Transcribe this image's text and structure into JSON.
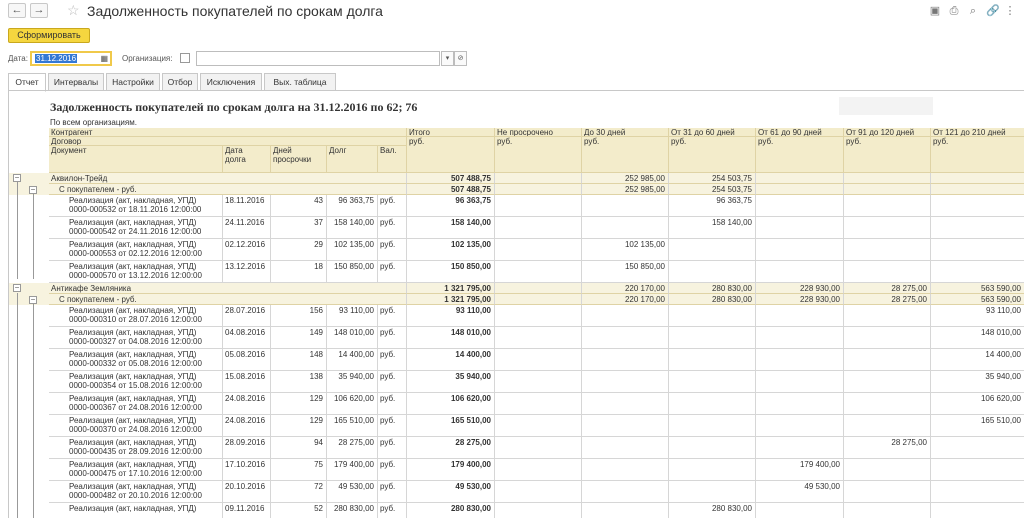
{
  "window": {
    "title": "Задолженность покупателей по срокам долга",
    "back": "←",
    "forward": "→",
    "star": "☆",
    "right_icons": [
      "▣",
      "⎙",
      "⌕",
      "🔗",
      "⋮"
    ]
  },
  "toolbar": {
    "generate_label": "Сформировать"
  },
  "params": {
    "date_label": "Дата:",
    "date_value": "31.12.2016",
    "org_label": "Организация:",
    "org_value": ""
  },
  "tabs": [
    {
      "label": "Отчет",
      "active": true
    },
    {
      "label": "Интервалы"
    },
    {
      "label": "Настройки"
    },
    {
      "label": "Отбор"
    },
    {
      "label": "Исключения"
    },
    {
      "label": "Вых. таблица"
    }
  ],
  "report": {
    "title": "Задолженность покупателей по срокам долга на 31.12.2016  по 62; 76",
    "subtitle": "По всем организациям.",
    "header": {
      "kontragent": "Контрагент",
      "dogovor": "Договор",
      "document": "Документ",
      "date": "Дата долга",
      "date_l1": "Дата",
      "date_l2": "долга",
      "days_l1": "Дней",
      "days_l2": "просрочки",
      "debt": "Долг",
      "cur": "Вал.",
      "columns": [
        "Итого",
        "Не просрочено",
        "До 30 дней",
        "От 31 до 60 дней",
        "От 61 до 90 дней",
        "От 91 до 120 дней",
        "От 121 до 210 дней"
      ],
      "currency": "руб."
    },
    "rows": [
      {
        "type": "c",
        "name": "Аквилон-Трейд",
        "vals": [
          "507 488,75",
          "",
          "252 985,00",
          "254 503,75",
          "",
          "",
          ""
        ]
      },
      {
        "type": "d",
        "name": "С покупателем - руб.",
        "vals": [
          "507 488,75",
          "",
          "252 985,00",
          "254 503,75",
          "",
          "",
          ""
        ]
      },
      {
        "type": "r",
        "l1": "Реализация (акт, накладная, УПД)",
        "l2": "0000-000532 от 18.11.2016 12:00:00",
        "date": "18.11.2016",
        "days": "43",
        "debt": "96 363,75",
        "cur": "руб.",
        "vals": [
          "96 363,75",
          "",
          "",
          "96 363,75",
          "",
          "",
          ""
        ]
      },
      {
        "type": "r",
        "l1": "Реализация (акт, накладная, УПД)",
        "l2": "0000-000542 от 24.11.2016 12:00:00",
        "date": "24.11.2016",
        "days": "37",
        "debt": "158 140,00",
        "cur": "руб.",
        "vals": [
          "158 140,00",
          "",
          "",
          "158 140,00",
          "",
          "",
          ""
        ]
      },
      {
        "type": "r",
        "l1": "Реализация (акт, накладная, УПД)",
        "l2": "0000-000553 от 02.12.2016 12:00:00",
        "date": "02.12.2016",
        "days": "29",
        "debt": "102 135,00",
        "cur": "руб.",
        "vals": [
          "102 135,00",
          "",
          "102 135,00",
          "",
          "",
          "",
          ""
        ]
      },
      {
        "type": "r",
        "l1": "Реализация (акт, накладная, УПД)",
        "l2": "0000-000570 от 13.12.2016 12:00:00",
        "date": "13.12.2016",
        "days": "18",
        "debt": "150 850,00",
        "cur": "руб.",
        "vals": [
          "150 850,00",
          "",
          "150 850,00",
          "",
          "",
          "",
          ""
        ]
      },
      {
        "type": "c",
        "name": "Антикафе Земляника",
        "vals": [
          "1 321 795,00",
          "",
          "220 170,00",
          "280 830,00",
          "228 930,00",
          "28 275,00",
          "563 590,00"
        ]
      },
      {
        "type": "d",
        "name": "С покупателем - руб.",
        "vals": [
          "1 321 795,00",
          "",
          "220 170,00",
          "280 830,00",
          "228 930,00",
          "28 275,00",
          "563 590,00"
        ]
      },
      {
        "type": "r",
        "l1": "Реализация (акт, накладная, УПД)",
        "l2": "0000-000310 от 28.07.2016 12:00:00",
        "date": "28.07.2016",
        "days": "156",
        "debt": "93 110,00",
        "cur": "руб.",
        "vals": [
          "93 110,00",
          "",
          "",
          "",
          "",
          "",
          "93 110,00"
        ]
      },
      {
        "type": "r",
        "l1": "Реализация (акт, накладная, УПД)",
        "l2": "0000-000327 от 04.08.2016 12:00:00",
        "date": "04.08.2016",
        "days": "149",
        "debt": "148 010,00",
        "cur": "руб.",
        "vals": [
          "148 010,00",
          "",
          "",
          "",
          "",
          "",
          "148 010,00"
        ]
      },
      {
        "type": "r",
        "l1": "Реализация (акт, накладная, УПД)",
        "l2": "0000-000332 от 05.08.2016 12:00:00",
        "date": "05.08.2016",
        "days": "148",
        "debt": "14 400,00",
        "cur": "руб.",
        "vals": [
          "14 400,00",
          "",
          "",
          "",
          "",
          "",
          "14 400,00"
        ]
      },
      {
        "type": "r",
        "l1": "Реализация (акт, накладная, УПД)",
        "l2": "0000-000354 от 15.08.2016 12:00:00",
        "date": "15.08.2016",
        "days": "138",
        "debt": "35 940,00",
        "cur": "руб.",
        "vals": [
          "35 940,00",
          "",
          "",
          "",
          "",
          "",
          "35 940,00"
        ]
      },
      {
        "type": "r",
        "l1": "Реализация (акт, накладная, УПД)",
        "l2": "0000-000367 от 24.08.2016 12:00:00",
        "date": "24.08.2016",
        "days": "129",
        "debt": "106 620,00",
        "cur": "руб.",
        "vals": [
          "106 620,00",
          "",
          "",
          "",
          "",
          "",
          "106 620,00"
        ]
      },
      {
        "type": "r",
        "l1": "Реализация (акт, накладная, УПД)",
        "l2": "0000-000370 от 24.08.2016 12:00:00",
        "date": "24.08.2016",
        "days": "129",
        "debt": "165 510,00",
        "cur": "руб.",
        "vals": [
          "165 510,00",
          "",
          "",
          "",
          "",
          "",
          "165 510,00"
        ]
      },
      {
        "type": "r",
        "l1": "Реализация (акт, накладная, УПД)",
        "l2": "0000-000435 от 28.09.2016 12:00:00",
        "date": "28.09.2016",
        "days": "94",
        "debt": "28 275,00",
        "cur": "руб.",
        "vals": [
          "28 275,00",
          "",
          "",
          "",
          "",
          "28 275,00",
          ""
        ]
      },
      {
        "type": "r",
        "l1": "Реализация (акт, накладная, УПД)",
        "l2": "0000-000475 от 17.10.2016 12:00:00",
        "date": "17.10.2016",
        "days": "75",
        "debt": "179 400,00",
        "cur": "руб.",
        "vals": [
          "179 400,00",
          "",
          "",
          "",
          "179 400,00",
          "",
          ""
        ]
      },
      {
        "type": "r",
        "l1": "Реализация (акт, накладная, УПД)",
        "l2": "0000-000482 от 20.10.2016 12:00:00",
        "date": "20.10.2016",
        "days": "72",
        "debt": "49 530,00",
        "cur": "руб.",
        "vals": [
          "49 530,00",
          "",
          "",
          "",
          "49 530,00",
          "",
          ""
        ]
      },
      {
        "type": "r",
        "l1": "Реализация (акт, накладная, УПД)",
        "l2": "",
        "date": "09.11.2016",
        "days": "52",
        "debt": "280 830,00",
        "cur": "руб.",
        "vals": [
          "280 830,00",
          "",
          "",
          "280 830,00",
          "",
          "",
          ""
        ]
      }
    ]
  }
}
